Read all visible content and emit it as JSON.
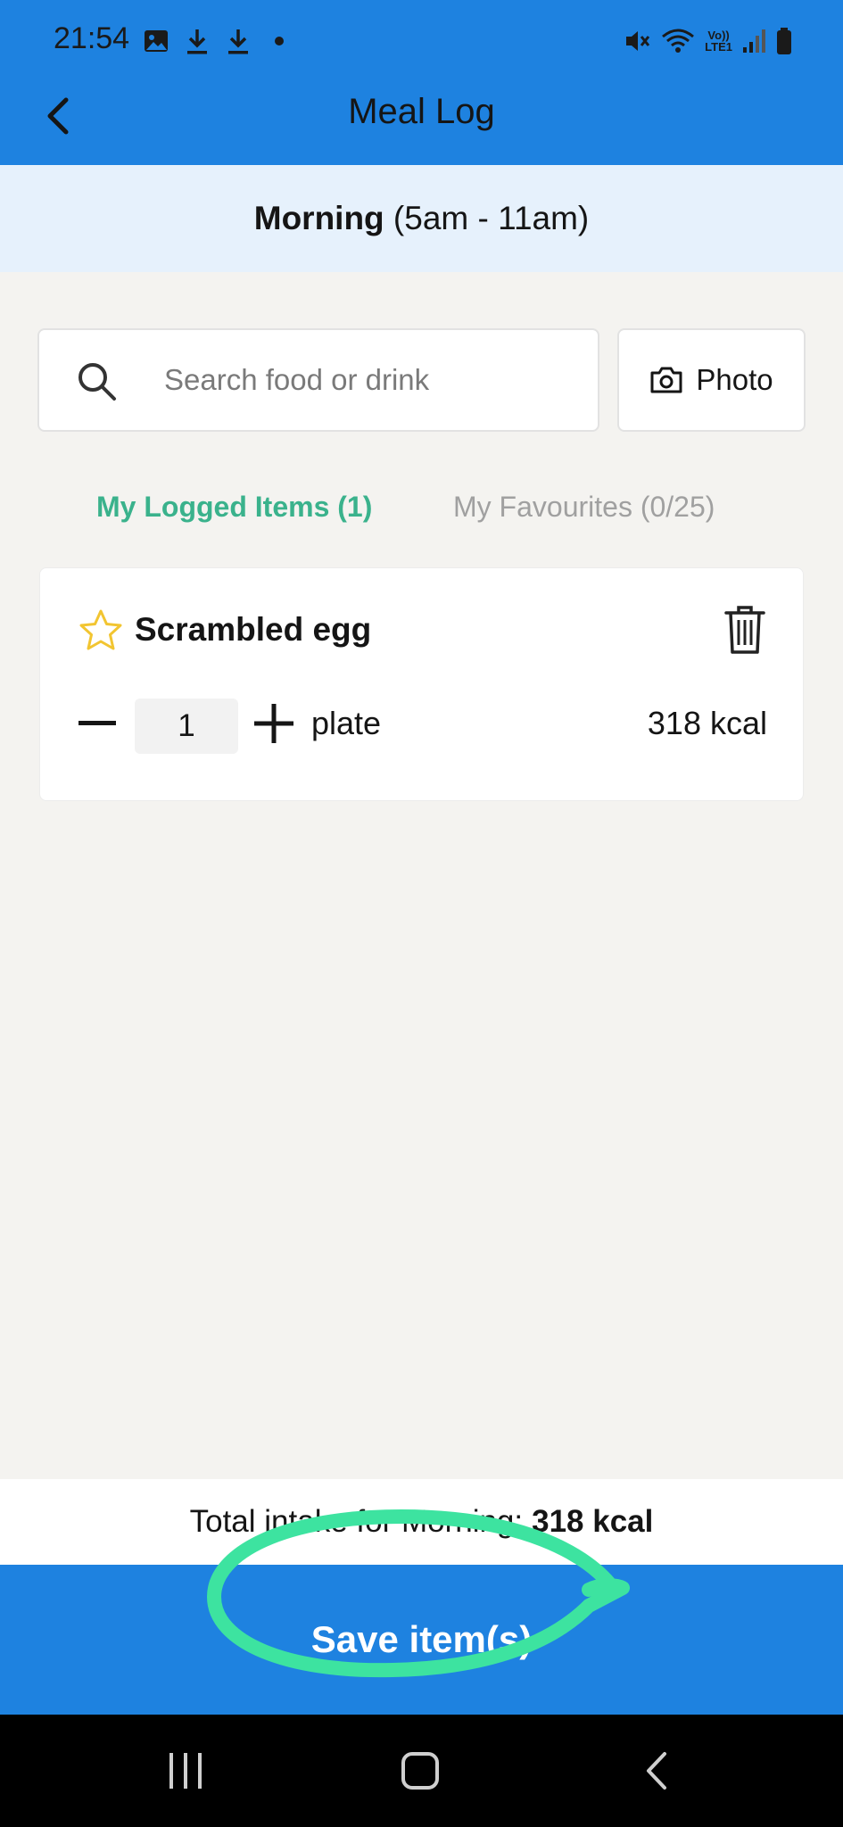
{
  "status_bar": {
    "time": "21:54",
    "lte_line1": "Vo))",
    "lte_line2": "LTE1",
    "left_icons": [
      "image-icon",
      "download-icon",
      "download-icon",
      "dot-icon"
    ],
    "right_icons": [
      "mute-icon",
      "wifi-icon",
      "lte-icon",
      "signal-icon",
      "battery-icon"
    ]
  },
  "header": {
    "title": "Meal Log",
    "back_icon": "chevron-left-icon",
    "color": "#1e82e0"
  },
  "meal_period": {
    "name": "Morning",
    "range": " (5am - 11am)"
  },
  "search": {
    "placeholder": "Search food or drink",
    "value": "",
    "icon": "search-icon"
  },
  "photo_button": {
    "label": "Photo",
    "icon": "camera-icon"
  },
  "tabs": [
    {
      "label": "My Logged Items (1)",
      "active": true,
      "color": "#3ab28c"
    },
    {
      "label": "My Favourites (0/25)",
      "active": false,
      "color": "#a0a0a0"
    }
  ],
  "items": [
    {
      "name": "Scrambled egg",
      "favourite": false,
      "quantity": "1",
      "unit": "plate",
      "kcal": "318 kcal"
    }
  ],
  "total": {
    "prefix": "Total intake for Morning:",
    "value": "318 kcal"
  },
  "save_button": {
    "label": "Save item(s)"
  },
  "nav": [
    "recent-apps-icon",
    "home-icon",
    "back-icon"
  ]
}
